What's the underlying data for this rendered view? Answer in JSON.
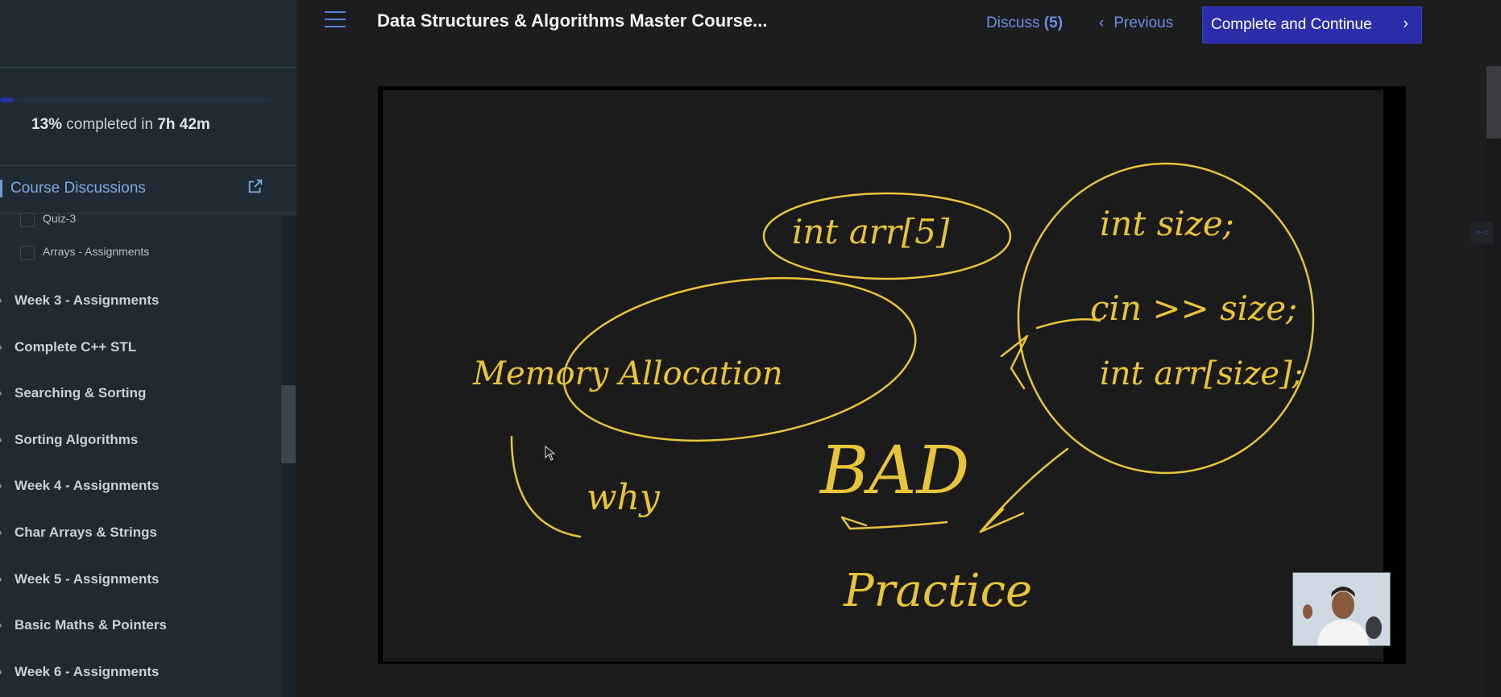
{
  "header": {
    "course_title": "Data Structures & Algorithms Master Course...",
    "discuss_label": "Discuss",
    "discuss_count": "(5)",
    "previous_label": "Previous",
    "complete_label": "Complete and Continue"
  },
  "sidebar": {
    "progress": {
      "fraction": 0.05,
      "percent_text": "13%",
      "middle_text": " completed in ",
      "time_text": "7h 42m"
    },
    "discussions_label": "Course Discussions",
    "sub_items": [
      {
        "label": "Quiz-3"
      },
      {
        "label": "Arrays - Assignments"
      }
    ],
    "sections": [
      {
        "label": "Week 3 - Assignments"
      },
      {
        "label": "Complete C++ STL"
      },
      {
        "label": "Searching & Sorting"
      },
      {
        "label": "Sorting Algorithms"
      },
      {
        "label": "Week 4 - Assignments"
      },
      {
        "label": "Char Arrays & Strings"
      },
      {
        "label": "Week 5 - Assignments"
      },
      {
        "label": "Basic Maths & Pointers"
      },
      {
        "label": "Week 6 - Assignments"
      }
    ]
  },
  "whiteboard": {
    "notes": [
      {
        "text": "int arr[5]"
      },
      {
        "text": "int size;"
      },
      {
        "text": "cin >> size;"
      },
      {
        "text": "int arr[size];"
      },
      {
        "text": "Memory Allocation"
      },
      {
        "text": "why"
      },
      {
        "text": "BAD"
      },
      {
        "text": "Practice"
      }
    ],
    "ink_color": "#e8c43a"
  },
  "colors": {
    "accent": "#2b2ea8",
    "link": "#6e8fe0",
    "sidebar_bg": "#1f2a33"
  }
}
